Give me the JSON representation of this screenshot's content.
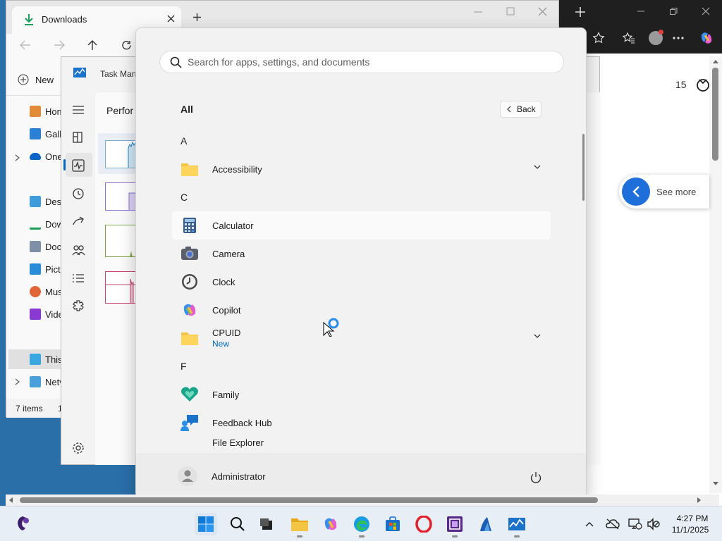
{
  "explorer": {
    "tab_title": "Downloads",
    "new_label": "New",
    "sidebar": [
      {
        "label": "Hom",
        "icon": "home-icon"
      },
      {
        "label": "Galle",
        "icon": "gallery-icon"
      },
      {
        "label": "One",
        "icon": "onedrive-icon"
      },
      {
        "label": "Desk",
        "icon": "desktop-icon"
      },
      {
        "label": "Dow",
        "icon": "downloads-icon"
      },
      {
        "label": "Docu",
        "icon": "documents-icon"
      },
      {
        "label": "Pictu",
        "icon": "pictures-icon"
      },
      {
        "label": "Mus",
        "icon": "music-icon"
      },
      {
        "label": "Vide",
        "icon": "videos-icon"
      },
      {
        "label": "This",
        "icon": "this-pc-icon"
      },
      {
        "label": "Netv",
        "icon": "network-icon"
      }
    ],
    "status": "7 items",
    "status_extra": "1"
  },
  "taskmgr": {
    "title": "Task Man",
    "section": "Perfor"
  },
  "edge": {
    "badge_count": "15",
    "see_more": "See more"
  },
  "start": {
    "search_placeholder": "Search for apps, settings, and documents",
    "all_label": "All",
    "back_label": "Back",
    "letters": [
      "A",
      "C",
      "F"
    ],
    "apps": [
      {
        "name": "Accessibility",
        "icon": "folder-icon"
      },
      {
        "name": "Calculator",
        "icon": "calculator-icon"
      },
      {
        "name": "Camera",
        "icon": "camera-icon"
      },
      {
        "name": "Clock",
        "icon": "clock-icon"
      },
      {
        "name": "Copilot",
        "icon": "copilot-icon"
      },
      {
        "name": "CPUID",
        "icon": "folder-icon",
        "badge": "New"
      },
      {
        "name": "Family",
        "icon": "family-icon"
      },
      {
        "name": "Feedback Hub",
        "icon": "feedback-hub-icon"
      },
      {
        "name": "File Explorer",
        "icon": "file-explorer-icon"
      }
    ],
    "user": "Administrator"
  },
  "taskbar": {
    "time": "4:27 PM",
    "date": "11/1/2025"
  },
  "colors": {
    "desktop": "#2a6fa8",
    "accent": "#0067c0",
    "folder": "#f4c542",
    "taskbar": "#e8eef5"
  }
}
